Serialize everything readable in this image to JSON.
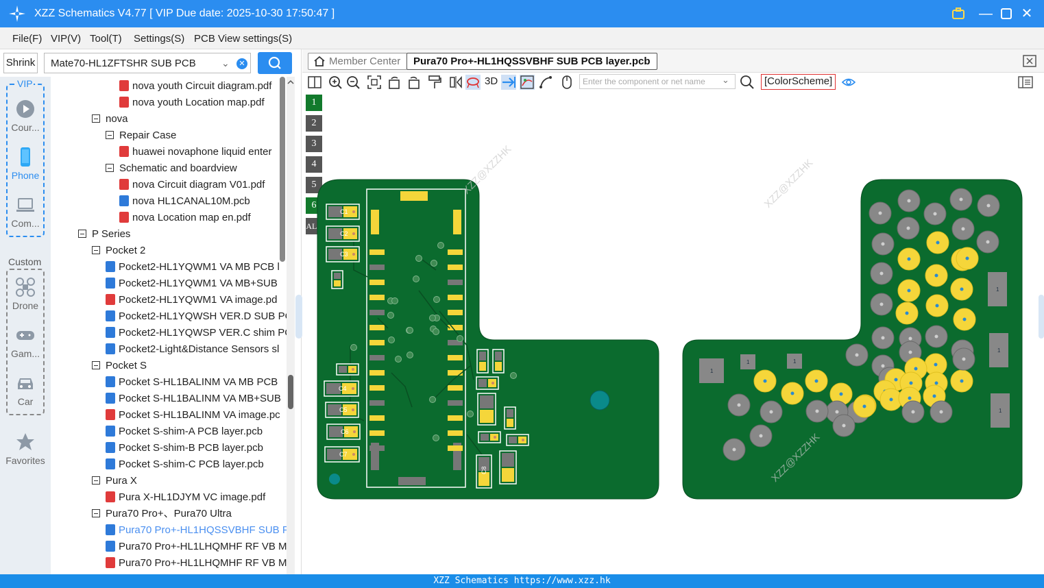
{
  "app": {
    "title": "XZZ Schematics V4.77 [ VIP Due date: 2025-10-30 17:50:47 ]"
  },
  "menu": [
    "File(F)",
    "VIP(V)",
    "Tool(T)",
    "Settings(S)",
    "PCB View settings(S)"
  ],
  "left": {
    "shrink_label": "Shrink",
    "pcb_select_value": "Mate70-HL1ZFTSHR SUB PCB",
    "vip_label": "VIP",
    "custom_label": "Custom",
    "vip_items": [
      "Cour...",
      "Phone",
      "Com..."
    ],
    "custom_items": [
      "Drone",
      "Gam...",
      "Car"
    ],
    "favorites_label": "Favorites"
  },
  "tree": [
    {
      "text": "nova youth Circuit diagram.pdf",
      "indent": 3,
      "kind": "pdf"
    },
    {
      "text": "nova youth Location map.pdf",
      "indent": 3,
      "kind": "pdf"
    },
    {
      "text": "nova",
      "indent": 1,
      "kind": "folder"
    },
    {
      "text": "Repair Case",
      "indent": 2,
      "kind": "folder"
    },
    {
      "text": "huawei novaphone liquid enter",
      "indent": 3,
      "kind": "pdf"
    },
    {
      "text": "Schematic and boardview",
      "indent": 2,
      "kind": "folder"
    },
    {
      "text": "nova Circuit diagram V01.pdf",
      "indent": 3,
      "kind": "pdf"
    },
    {
      "text": "nova HL1CANAL10M.pcb",
      "indent": 3,
      "kind": "pcb"
    },
    {
      "text": "nova Location map en.pdf",
      "indent": 3,
      "kind": "pdf"
    },
    {
      "text": "P Series",
      "indent": 0,
      "kind": "folder"
    },
    {
      "text": "Pocket 2",
      "indent": 1,
      "kind": "folder"
    },
    {
      "text": "Pocket2-HL1YQWM1 VA MB PCB l",
      "indent": 2,
      "kind": "pcb"
    },
    {
      "text": "Pocket2-HL1YQWM1 VA MB+SUB",
      "indent": 2,
      "kind": "pcb"
    },
    {
      "text": "Pocket2-HL1YQWM1 VA image.pd",
      "indent": 2,
      "kind": "pdf"
    },
    {
      "text": "Pocket2-HL1YQWSH VER.D SUB PC",
      "indent": 2,
      "kind": "pcb"
    },
    {
      "text": "Pocket2-HL1YQWSP VER.C shim PC",
      "indent": 2,
      "kind": "pcb"
    },
    {
      "text": "Pocket2-Light&Distance Sensors sl",
      "indent": 2,
      "kind": "pcb"
    },
    {
      "text": "Pocket S",
      "indent": 1,
      "kind": "folder"
    },
    {
      "text": "Pocket S-HL1BALINM VA MB PCB",
      "indent": 2,
      "kind": "pcb"
    },
    {
      "text": "Pocket S-HL1BALINM VA MB+SUB",
      "indent": 2,
      "kind": "pcb"
    },
    {
      "text": "Pocket S-HL1BALINM VA image.pc",
      "indent": 2,
      "kind": "pdf"
    },
    {
      "text": "Pocket S-shim-A PCB layer.pcb",
      "indent": 2,
      "kind": "pcb"
    },
    {
      "text": "Pocket S-shim-B PCB layer.pcb",
      "indent": 2,
      "kind": "pcb"
    },
    {
      "text": "Pocket S-shim-C PCB layer.pcb",
      "indent": 2,
      "kind": "pcb"
    },
    {
      "text": "Pura X",
      "indent": 1,
      "kind": "folder"
    },
    {
      "text": "Pura X-HL1DJYM VC image.pdf",
      "indent": 2,
      "kind": "pdf"
    },
    {
      "text": "Pura70 Pro+、Pura70 Ultra",
      "indent": 1,
      "kind": "folder"
    },
    {
      "text": "Pura70 Pro+-HL1HQSSVBHF SUB F",
      "indent": 2,
      "kind": "pcb",
      "selected": true
    },
    {
      "text": "Pura70 Pro+-HL1LHQMHF RF VB M",
      "indent": 2,
      "kind": "pcb"
    },
    {
      "text": "Pura70 Pro+-HL1LHQMHF RF VB M",
      "indent": 2,
      "kind": "pdf"
    }
  ],
  "tabs": {
    "member": "Member Center",
    "active": "Pura70 Pro+-HL1HQSSVBHF SUB PCB layer.pcb"
  },
  "toolbar": {
    "label_3d": "3D",
    "search_placeholder": "Enter the component or net name",
    "color_scheme": "[ColorScheme]"
  },
  "layers": [
    "1",
    "2",
    "3",
    "4",
    "5",
    "6",
    "ALL"
  ],
  "board": {
    "caps": [
      "C1",
      "C2",
      "C3",
      "C4",
      "C5",
      "C6",
      "C7",
      "C8"
    ],
    "watermark": "XZZ@XZZHK",
    "pin_label": "1"
  },
  "status": "XZZ Schematics https://www.xzz.hk",
  "colors": {
    "accent": "#2b8df0",
    "board": "#0b6b2e",
    "pad": "#f5d63a"
  }
}
